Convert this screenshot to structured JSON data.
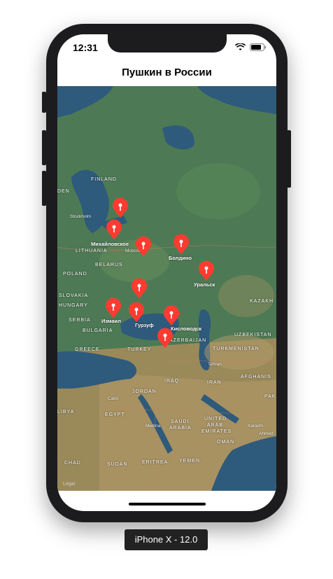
{
  "status_bar": {
    "time": "12:31"
  },
  "navbar": {
    "title": "Пушкин в России"
  },
  "map": {
    "region_labels": {
      "finland": "FINLAND",
      "sweden": "DEN",
      "lithuania": "LITHUANIA",
      "belarus": "BELARUS",
      "poland": "POLAND",
      "slovakia": "SLOVAKIA",
      "hungary": "HUNGARY",
      "serbia": "SERBIA",
      "bulgaria": "BULGARIA",
      "greece": "GREECE",
      "turkey": "TURKEY",
      "azerbaijan": "AZERBAIJAN",
      "kazakhstan": "KAZAKH",
      "uzbekistan": "UZBEKISTAN",
      "turkmenistan": "TURKMENISTAN",
      "afghanistan": "AFGHANIS",
      "iran": "IRAN",
      "iraq": "IRAQ",
      "jordan": "JORDAN",
      "egypt": "EGYPT",
      "libya": "LIBYA",
      "saudi_arabia_1": "SAUDI",
      "saudi_arabia_2": "ARABIA",
      "uae_1": "UNITED",
      "uae_2": "ARAB",
      "uae_3": "EMIRATES",
      "oman": "OMAN",
      "sudan": "SUDAN",
      "chad": "CHAD",
      "eritrea": "ERITREA",
      "yemen": "YEMEN",
      "pakistan": "PAK"
    },
    "small_labels": {
      "stockholm": "Stockholm",
      "moscow": "Moscow",
      "tehran": "Tehran",
      "cairo": "Cairo",
      "medina": "Medina",
      "karachi": "Karachi",
      "ahmed": "Ahmed"
    },
    "pin_labels": {
      "mikhailovskoe": "Михайловское",
      "boldino": "Болдино",
      "uralsk": "Уральск",
      "izmail": "Измаил",
      "gurzuf": "Гурзуф",
      "kislovodsk": "Кисловодск"
    },
    "pin_color": "#ff3b30",
    "legal": "Legal"
  },
  "device_label": "iPhone X - 12.0"
}
